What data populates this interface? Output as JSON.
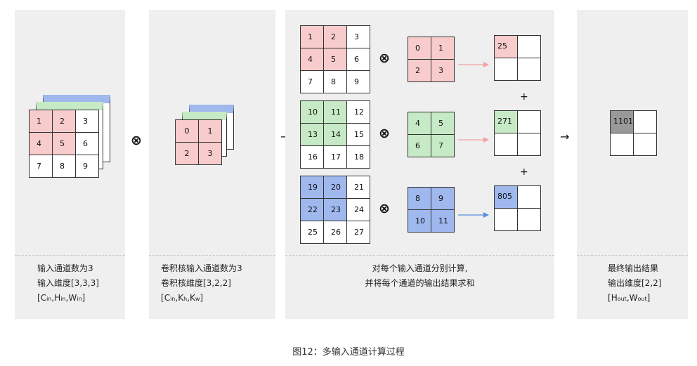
{
  "input": {
    "rows": [
      [
        "1",
        "2",
        "3"
      ],
      [
        "4",
        "5",
        "6"
      ],
      [
        "7",
        "8",
        "9"
      ]
    ],
    "caption_line1": "输入通道数为3",
    "caption_line2": "输入维度[3,3,3]",
    "dims": [
      {
        "m": "C",
        "s": "in"
      },
      {
        "m": "H",
        "s": "in"
      },
      {
        "m": "W",
        "s": "in"
      }
    ]
  },
  "kernel": {
    "rows": [
      [
        "0",
        "1"
      ],
      [
        "2",
        "3"
      ]
    ],
    "caption_line1": "卷积核输入通道数为3",
    "caption_line2": "卷积核维度[3,2,2]",
    "dims": [
      {
        "m": "C",
        "s": "in"
      },
      {
        "m": "K",
        "s": "h"
      },
      {
        "m": "K",
        "s": "w"
      }
    ]
  },
  "channels": [
    {
      "color": "#f8cccc",
      "input": [
        [
          "1",
          "2",
          "3"
        ],
        [
          "4",
          "5",
          "6"
        ],
        [
          "7",
          "8",
          "9"
        ]
      ],
      "kernel": [
        [
          "0",
          "1"
        ],
        [
          "2",
          "3"
        ]
      ],
      "result": "25",
      "arrow_color": "#f4a0a0"
    },
    {
      "color": "#c6eac5",
      "input": [
        [
          "10",
          "11",
          "12"
        ],
        [
          "13",
          "14",
          "15"
        ],
        [
          "16",
          "17",
          "18"
        ]
      ],
      "kernel": [
        [
          "4",
          "5"
        ],
        [
          "6",
          "7"
        ]
      ],
      "result": "271",
      "arrow_color": "#f4a0a0"
    },
    {
      "color": "#9fb8ee",
      "input": [
        [
          "19",
          "20",
          "21"
        ],
        [
          "22",
          "23",
          "24"
        ],
        [
          "25",
          "26",
          "27"
        ]
      ],
      "kernel": [
        [
          "8",
          "9"
        ],
        [
          "10",
          "11"
        ]
      ],
      "result": "805",
      "arrow_color": "#5b8ed6"
    }
  ],
  "operators": {
    "conv": "⊗",
    "plus": "+",
    "arrow": "→"
  },
  "middle": {
    "caption_line1": "对每个输入通道分别计算,",
    "caption_line2": "并将每个通道的输出结果求和"
  },
  "output": {
    "value": "1101",
    "caption_line1": "最终输出结果",
    "caption_line2": "输出维度[2,2]",
    "dims": [
      {
        "m": "H",
        "s": "out"
      },
      {
        "m": "W",
        "s": "out"
      }
    ]
  },
  "figure_title": "图12：多输入通道计算过程"
}
